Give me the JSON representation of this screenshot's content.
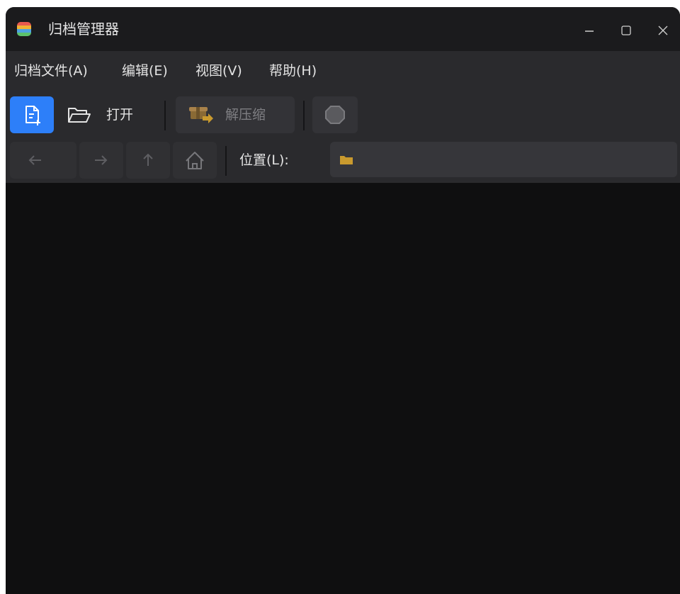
{
  "window": {
    "title": "归档管理器"
  },
  "titlebar": {
    "app_icon": "archive-manager-icon",
    "minimize": "—",
    "maximize": "☐",
    "close": "✕"
  },
  "menubar": {
    "items": [
      {
        "label": "归档文件(A)"
      },
      {
        "label": "编辑(E)"
      },
      {
        "label": "视图(V)"
      },
      {
        "label": "帮助(H)"
      }
    ]
  },
  "toolbar": {
    "new_icon": "new-archive-icon",
    "open_icon": "folder-open-icon",
    "open_label": "打开",
    "extract_icon": "extract-box-icon",
    "extract_label": "解压缩",
    "stop_icon": "stop-icon"
  },
  "location": {
    "back_icon": "arrow-left-icon",
    "forward_icon": "arrow-right-icon",
    "up_icon": "arrow-up-icon",
    "home_icon": "home-icon",
    "label": "位置(L):",
    "value": ""
  },
  "colors": {
    "accent": "#2d7ff9",
    "folder": "#c99a2e",
    "toolbar_bg": "#2a2a2d",
    "content_bg": "#0f0f10"
  }
}
